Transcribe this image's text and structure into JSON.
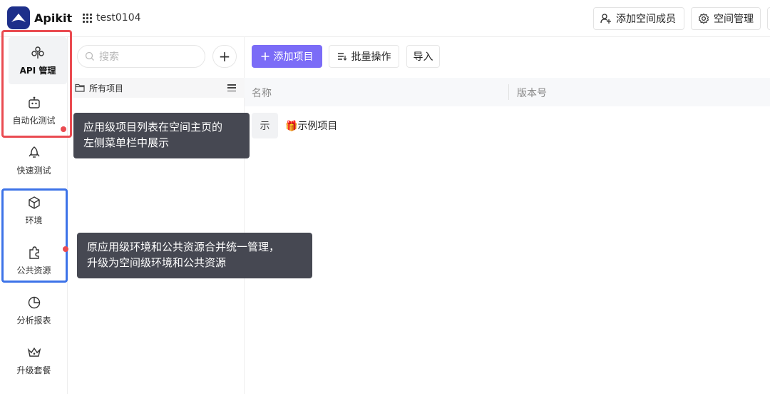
{
  "header": {
    "brand": "Apikit",
    "space_name": "test0104",
    "add_member_label": "添加空间成员",
    "space_manage_label": "空间管理"
  },
  "sidebar": {
    "items": [
      {
        "label": "API 管理",
        "icon": "api-icon",
        "active": true
      },
      {
        "label": "自动化测试",
        "icon": "robot-icon"
      },
      {
        "label": "快速测试",
        "icon": "rocket-icon"
      },
      {
        "label": "环境",
        "icon": "cube-icon"
      },
      {
        "label": "公共资源",
        "icon": "puzzle-icon"
      },
      {
        "label": "分析报表",
        "icon": "pie-chart-icon"
      },
      {
        "label": "升级套餐",
        "icon": "crown-icon"
      }
    ]
  },
  "projects_panel": {
    "search_placeholder": "搜索",
    "add_symbol": "+",
    "all_projects_label": "所有项目"
  },
  "main": {
    "add_project_label": "添加项目",
    "batch_label": "批量操作",
    "import_label": "导入",
    "columns": [
      "名称",
      "版本号"
    ],
    "rows": [
      {
        "avatar": "示",
        "name": "示例项目"
      }
    ]
  },
  "tooltips": {
    "tip1_line1": "应用级项目列表在空间主页的",
    "tip1_line2": "左侧菜单栏中展示",
    "tip2_line1": "原应用级环境和公共资源合并统一管理，",
    "tip2_line2": "升级为空间级环境和公共资源"
  },
  "colors": {
    "brand": "#1d2f8a",
    "primary_button": "#7b6cf7",
    "highlight_red": "#ea4b51",
    "highlight_blue": "#3d73e8",
    "tooltip_bg": "#464852"
  }
}
